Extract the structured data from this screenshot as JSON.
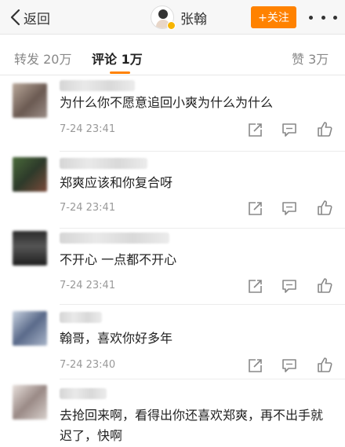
{
  "nav": {
    "back_label": "返回",
    "user_name": "张翰",
    "follow_label": "+关注"
  },
  "tabs": {
    "repost": "转发 20万",
    "comments": "评论 1万",
    "likes": "赞 3万"
  },
  "comments": [
    {
      "text": "为什么你不愿意追回小爽为什么为什么",
      "time": "7-24 23:41"
    },
    {
      "text": "郑爽应该和你复合呀",
      "time": "7-24 23:41"
    },
    {
      "text": "不开心 一点都不开心",
      "time": "7-24 23:41"
    },
    {
      "text": "翰哥，喜欢你好多年",
      "time": "7-24 23:40"
    },
    {
      "text": "去抢回来啊，看得出你还喜欢郑爽，再不出手就迟了，快啊",
      "time": ""
    }
  ],
  "colors": {
    "accent": "#ff8200",
    "text": "#222222",
    "muted": "#999999"
  },
  "icons": [
    "back-chevron-icon",
    "more-dots-icon",
    "repost-icon",
    "comment-icon",
    "like-icon"
  ]
}
